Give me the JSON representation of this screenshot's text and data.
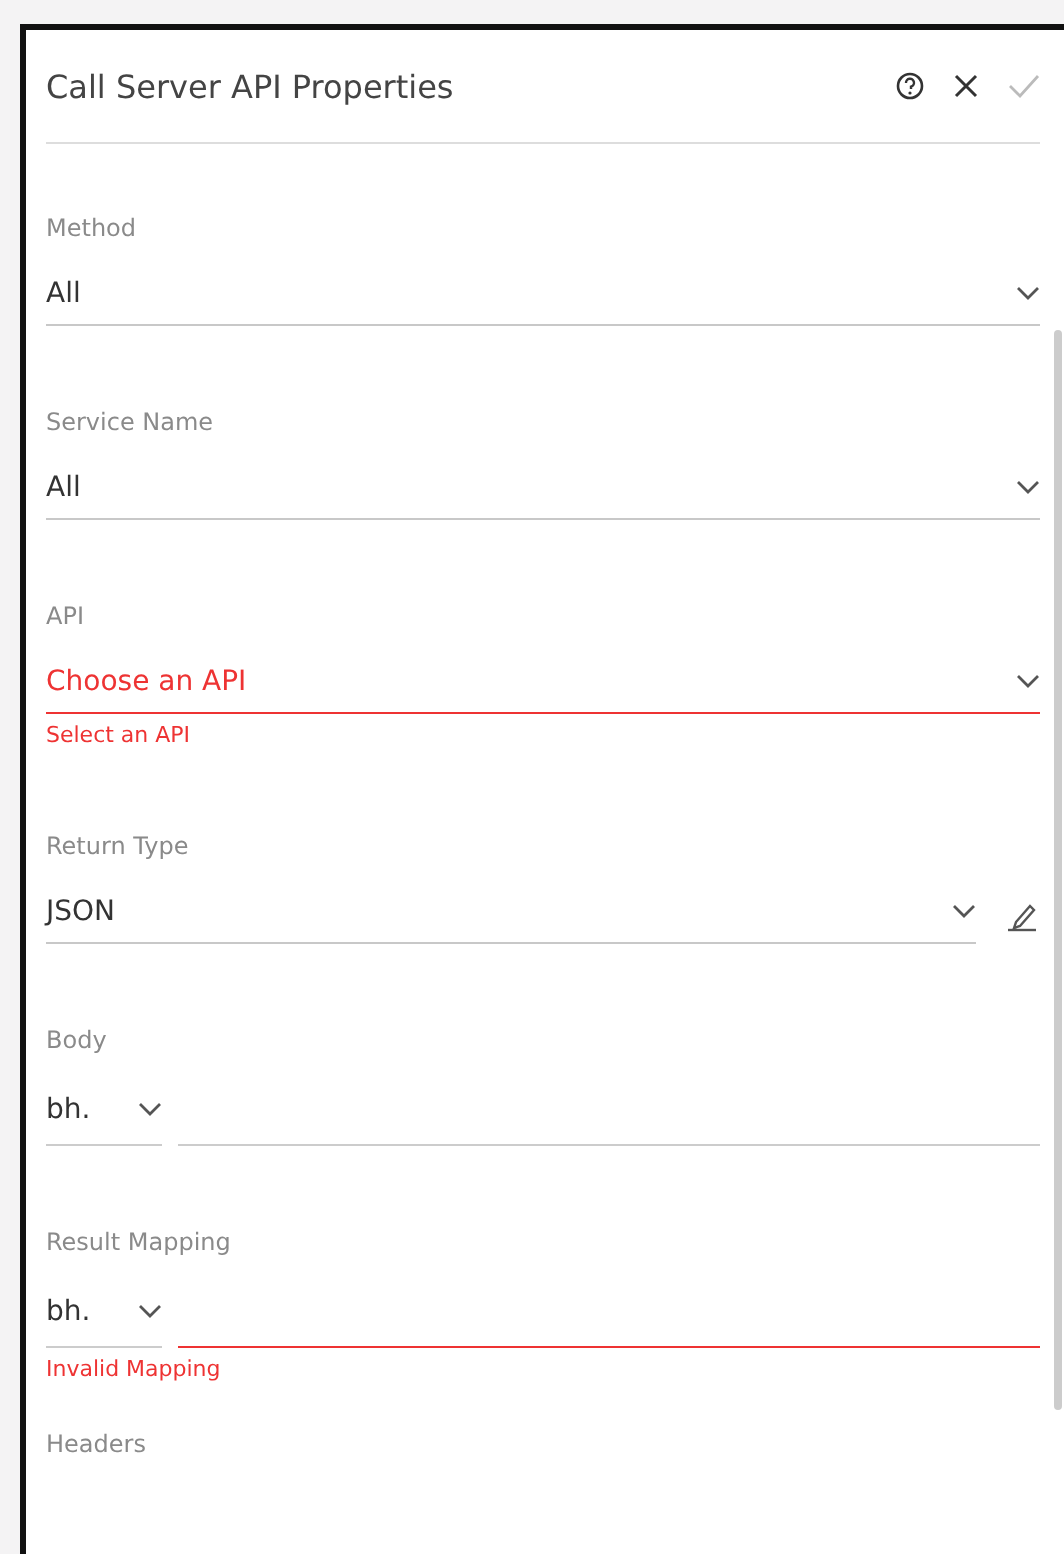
{
  "panel": {
    "title": "Call Server API Properties"
  },
  "fields": [
    {
      "kind": "select",
      "label": "Method",
      "value": "All",
      "error": false
    },
    {
      "kind": "select",
      "label": "Service Name",
      "value": "All",
      "error": false
    },
    {
      "kind": "select",
      "label": "API",
      "value": "Choose an API",
      "error": true,
      "message": "Select an API"
    },
    {
      "kind": "select-edit",
      "label": "Return Type",
      "value": "JSON",
      "error": false
    },
    {
      "kind": "mapping",
      "label": "Body",
      "value": "bh.",
      "error": false
    },
    {
      "kind": "mapping",
      "label": "Result Mapping",
      "value": "bh.",
      "error": true,
      "message": "Invalid Mapping"
    },
    {
      "kind": "heading",
      "label": "Headers"
    }
  ]
}
